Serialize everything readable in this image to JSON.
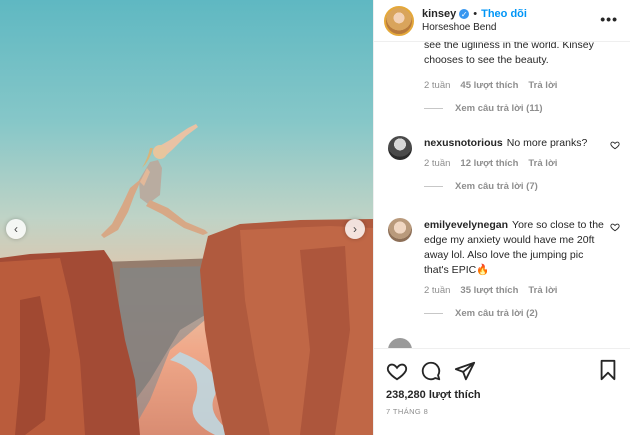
{
  "post": {
    "username": "kinsey",
    "follow_label": "Theo dõi",
    "location": "Horseshoe Bend",
    "more_label": "•••"
  },
  "comments": [
    {
      "text": "see the ugliness in the world. Kinsey chooses to see the beauty.",
      "time": "2 tuần",
      "likes": "45 lượt thích",
      "reply": "Trả lời",
      "view_replies": "Xem câu trả lời (11)"
    },
    {
      "user": "nexusnotorious",
      "text": "No more pranks?",
      "time": "2 tuần",
      "likes": "12 lượt thích",
      "reply": "Trả lời",
      "view_replies": "Xem câu trả lời (7)"
    },
    {
      "user": "emilyevelynegan",
      "text": "Yore so close to the edge my anxiety would have me 20ft away lol. Also love the jumping pic that's EPIC🔥",
      "time": "2 tuần",
      "likes": "35 lượt thích",
      "reply": "Trả lời",
      "view_replies": "Xem câu trả lời (2)"
    }
  ],
  "actions": {
    "like_count": "238,280 lượt thích",
    "timestamp": "7 THÁNG 8"
  },
  "nav": {
    "prev": "‹",
    "next": "›"
  },
  "icons": [
    "verified-badge-icon",
    "more-options-icon",
    "heart-icon",
    "comment-icon",
    "share-icon",
    "bookmark-icon",
    "chevron-left-icon",
    "chevron-right-icon"
  ],
  "colors": {
    "accent": "#0095f6",
    "text": "#262626",
    "muted": "#8e8e8e"
  }
}
